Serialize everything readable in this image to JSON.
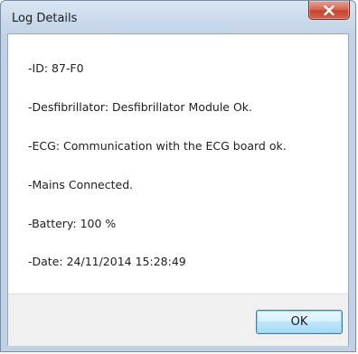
{
  "window": {
    "title": "Log Details"
  },
  "details": {
    "lines": [
      "-ID: 87-F0",
      "-Desfibrillator: Desfibrillator Module Ok.",
      "-ECG: Communication with the ECG board ok.",
      "-Mains Connected.",
      "-Battery: 100 %",
      "-Date: 24/11/2014 15:28:49"
    ]
  },
  "footer": {
    "ok_label": "OK"
  },
  "icons": {
    "close": "close-icon"
  },
  "colors": {
    "close_button": "#c6452d",
    "ok_button_border": "#3c7fb1",
    "titlebar": "#c5d6ea"
  }
}
